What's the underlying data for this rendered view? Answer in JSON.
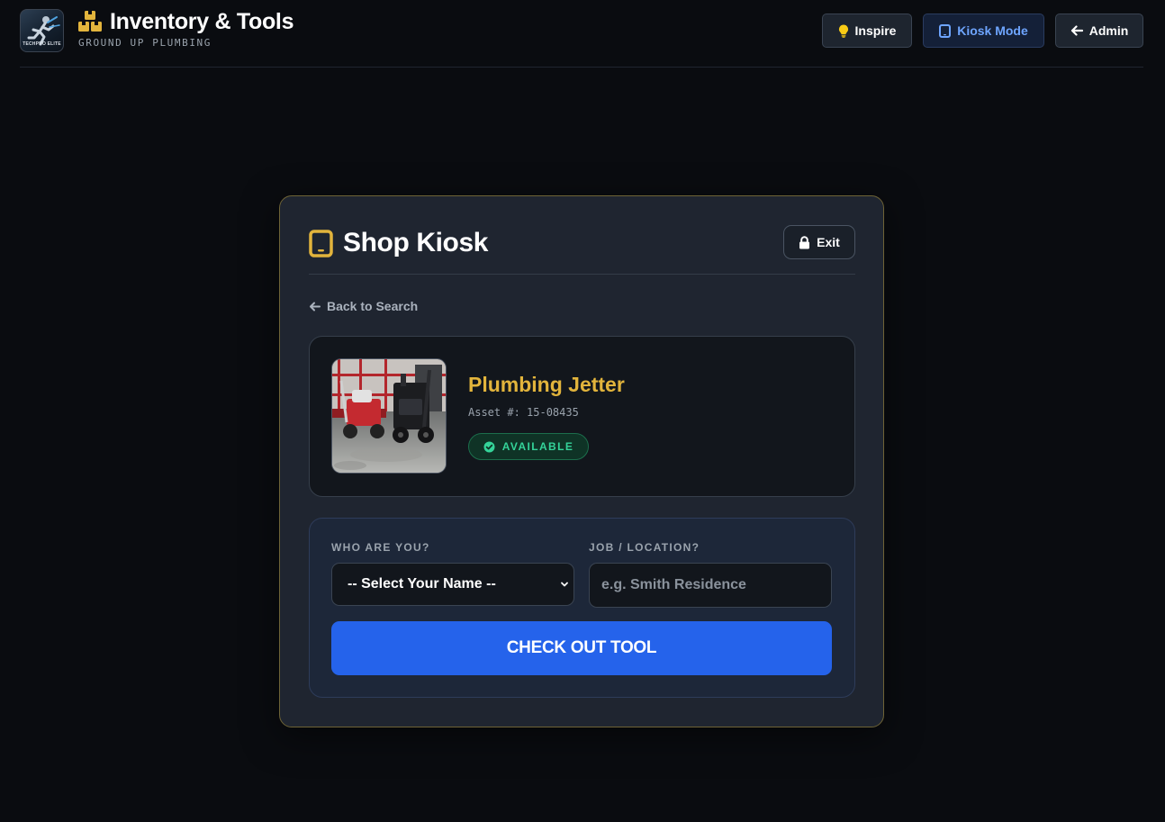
{
  "header": {
    "title": "Inventory & Tools",
    "subtitle": "GROUND UP PLUMBING",
    "logo_text": "TECHPRO ELITE",
    "buttons": {
      "inspire": "Inspire",
      "kiosk": "Kiosk Mode",
      "admin": "Admin"
    }
  },
  "kiosk": {
    "title": "Shop Kiosk",
    "exit_label": "Exit",
    "back_label": "Back to Search",
    "tool": {
      "name": "Plumbing Jetter",
      "asset_line": "Asset #: 15-08435",
      "status": "AVAILABLE"
    },
    "form": {
      "who_label": "WHO ARE YOU?",
      "who_selected": "-- Select Your Name --",
      "job_label": "JOB / LOCATION?",
      "job_placeholder": "e.g. Smith Residence",
      "job_value": "",
      "submit_label": "CHECK OUT TOOL"
    }
  },
  "colors": {
    "accent_gold": "#e2b43c",
    "primary_blue": "#2563eb",
    "kiosk_blue_text": "#6ea5ff",
    "status_green": "#34d399",
    "background": "#0a0c10",
    "card": "#1f2530"
  },
  "icons": {
    "header_title": "boxes-icon",
    "inspire": "lightbulb-icon",
    "kiosk": "tablet-icon",
    "admin": "arrow-left-icon",
    "card_title": "tablet-icon",
    "exit": "lock-icon",
    "back": "arrow-left-icon",
    "status": "check-circle-icon",
    "select": "chevron-down-icon"
  }
}
